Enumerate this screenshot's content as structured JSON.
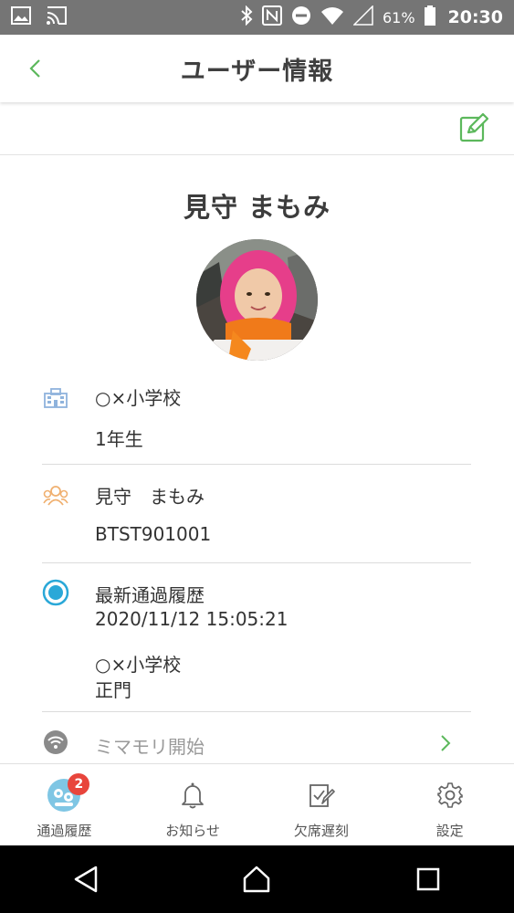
{
  "status_bar": {
    "battery_percent": "61%",
    "time": "20:30"
  },
  "header": {
    "title": "ユーザー情報"
  },
  "profile": {
    "name": "見守 まもみ"
  },
  "school": {
    "name": "○×小学校",
    "grade": "1年生"
  },
  "guardian": {
    "name": "見守　まもみ",
    "id": "BTST901001"
  },
  "latest_passage": {
    "title": "最新通過履歴",
    "datetime": "2020/11/12 15:05:21",
    "location": "○×小学校",
    "gate": "正門"
  },
  "mimamori": {
    "label": "ミマモリ開始"
  },
  "bottom_nav": {
    "items": [
      {
        "label": "通過履歴",
        "badge": "2"
      },
      {
        "label": "お知らせ"
      },
      {
        "label": "欠席遅刻"
      },
      {
        "label": "設定"
      }
    ]
  },
  "colors": {
    "accent_green": "#5cb85c",
    "school_icon_blue": "#8fb3dc",
    "guardian_icon_orange": "#f0b070",
    "radio_blue": "#2aa8d8",
    "badge_red": "#e8453c"
  }
}
